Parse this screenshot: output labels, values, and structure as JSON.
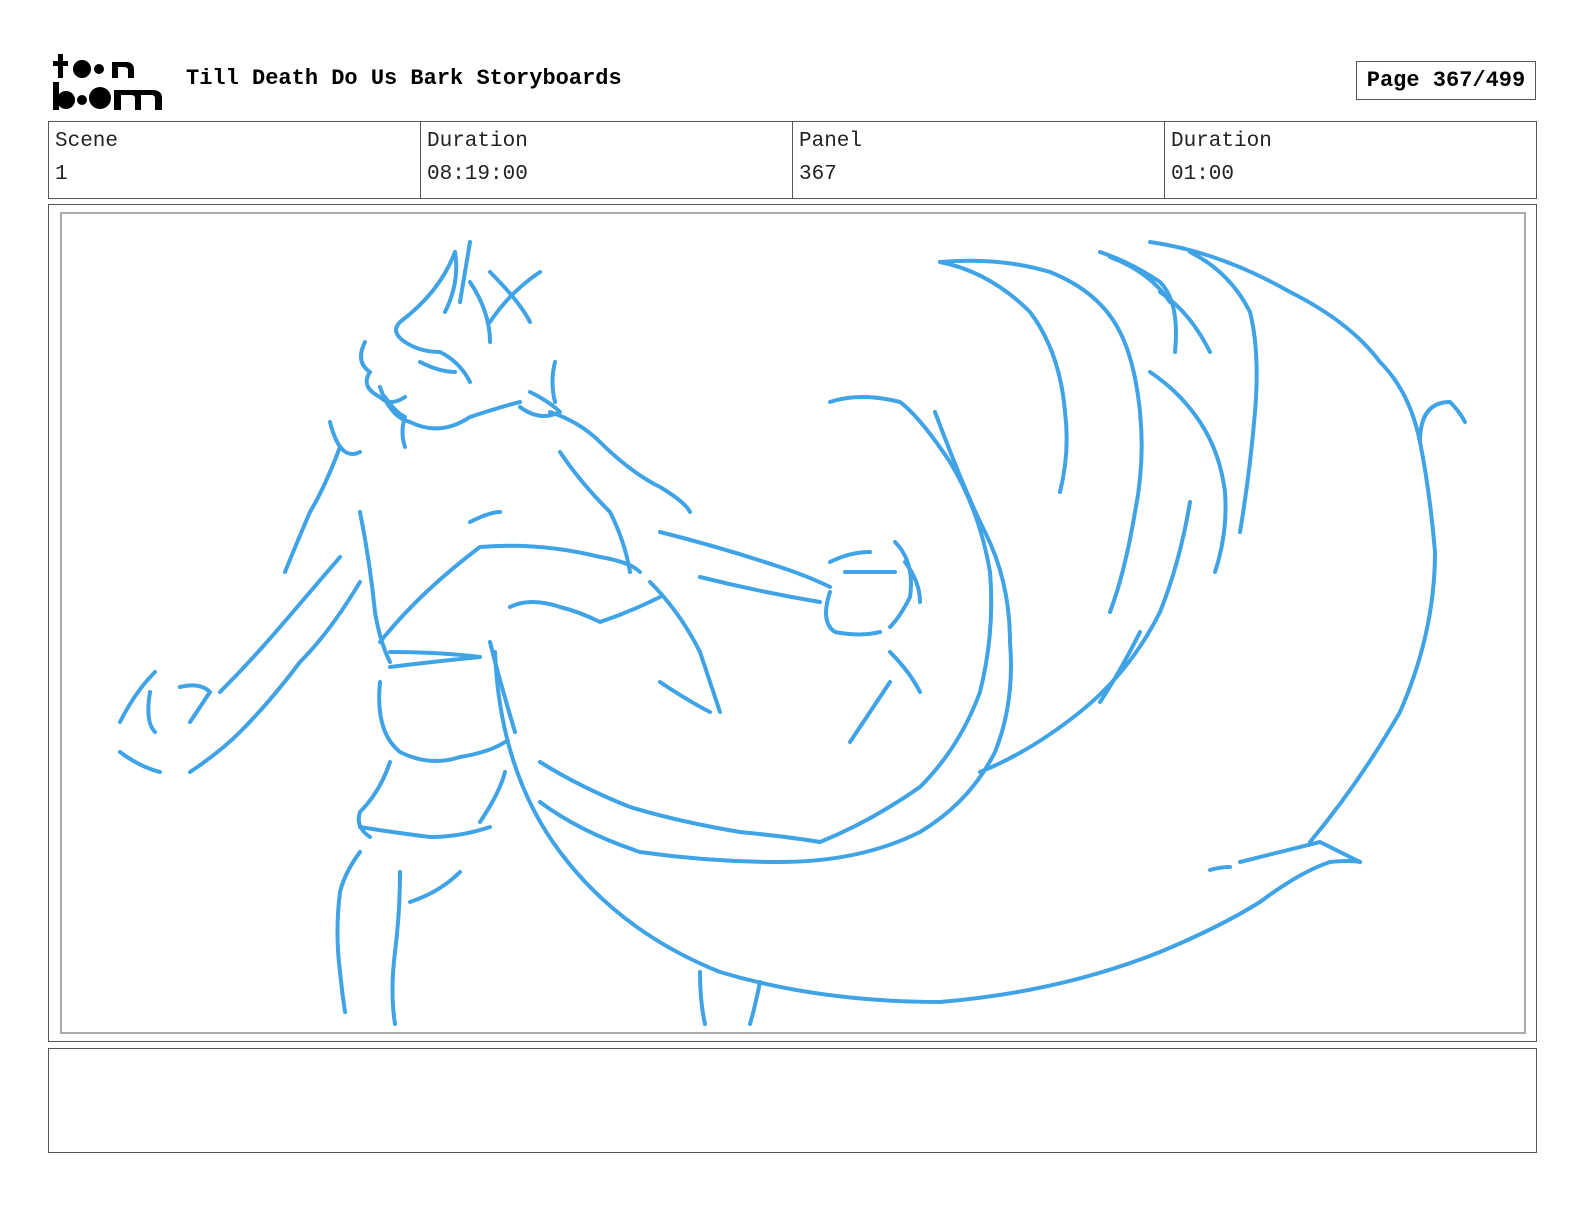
{
  "header": {
    "logo_text_top": "toon",
    "logo_text_bottom": "boom",
    "title": "Till Death Do Us Bark Storyboards",
    "page_label": "Page 367/499"
  },
  "info": {
    "scene_label": "Scene",
    "scene_value": "1",
    "scene_duration_label": "Duration",
    "scene_duration_value": "08:19:00",
    "panel_label": "Panel",
    "panel_value": "367",
    "panel_duration_label": "Duration",
    "panel_duration_value": "01:00"
  },
  "panel": {
    "sketch_color": "#3fa3e6"
  },
  "notes": {
    "text": ""
  }
}
